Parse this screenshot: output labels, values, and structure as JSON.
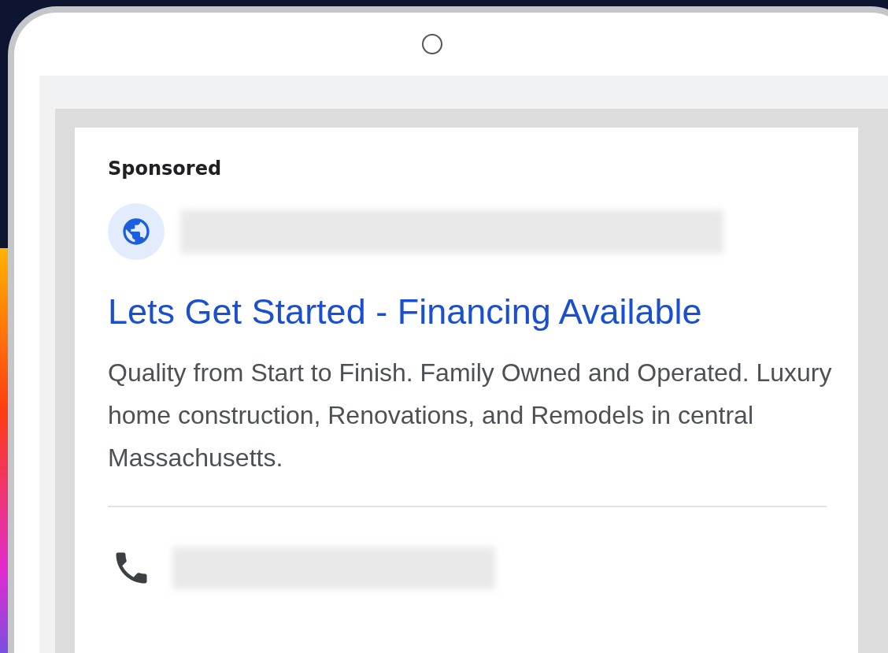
{
  "ad": {
    "label": "Sponsored",
    "headline": "Lets Get Started - Financing Available",
    "description": "Quality from Start to Finish. Family Owned and Operated. Luxury home construction, Renovations, and Remodels in central Massachusetts."
  }
}
